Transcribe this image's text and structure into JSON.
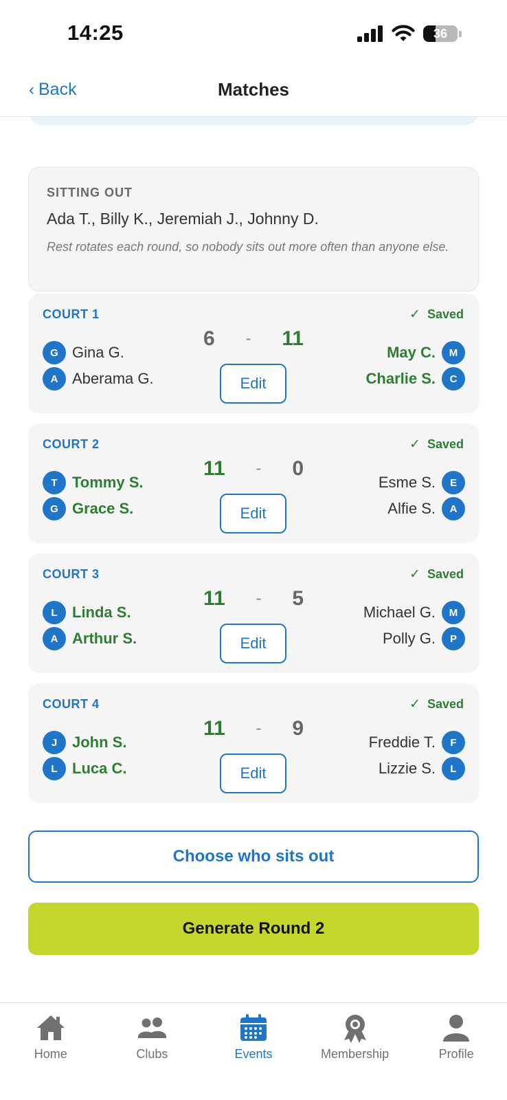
{
  "status_bar": {
    "time": "14:25",
    "battery": "36",
    "battery_level": 0.36
  },
  "nav": {
    "back_label": "Back",
    "title": "Matches"
  },
  "sitting_out": {
    "heading": "SITTING OUT",
    "names": "Ada T., Billy K., Jeremiah J., Johnny D.",
    "note": "Rest rotates each round, so nobody sits out more often than anyone else."
  },
  "courts": [
    {
      "label": "COURT 1",
      "status": "Saved",
      "edit_label": "Edit",
      "score_left": "6",
      "score_sep": "-",
      "score_right": "11",
      "winner": "right",
      "left_players": [
        {
          "initial": "G",
          "name": "Gina G."
        },
        {
          "initial": "A",
          "name": "Aberama G."
        }
      ],
      "right_players": [
        {
          "initial": "M",
          "name": "May C."
        },
        {
          "initial": "C",
          "name": "Charlie S."
        }
      ]
    },
    {
      "label": "COURT 2",
      "status": "Saved",
      "edit_label": "Edit",
      "score_left": "11",
      "score_sep": "-",
      "score_right": "0",
      "winner": "left",
      "left_players": [
        {
          "initial": "T",
          "name": "Tommy S."
        },
        {
          "initial": "G",
          "name": "Grace S."
        }
      ],
      "right_players": [
        {
          "initial": "E",
          "name": "Esme S."
        },
        {
          "initial": "A",
          "name": "Alfie S."
        }
      ]
    },
    {
      "label": "COURT 3",
      "status": "Saved",
      "edit_label": "Edit",
      "score_left": "11",
      "score_sep": "-",
      "score_right": "5",
      "winner": "left",
      "left_players": [
        {
          "initial": "L",
          "name": "Linda S."
        },
        {
          "initial": "A",
          "name": "Arthur S."
        }
      ],
      "right_players": [
        {
          "initial": "M",
          "name": "Michael G."
        },
        {
          "initial": "P",
          "name": "Polly G."
        }
      ]
    },
    {
      "label": "COURT 4",
      "status": "Saved",
      "edit_label": "Edit",
      "score_left": "11",
      "score_sep": "-",
      "score_right": "9",
      "winner": "left",
      "left_players": [
        {
          "initial": "J",
          "name": "John S."
        },
        {
          "initial": "L",
          "name": "Luca C."
        }
      ],
      "right_players": [
        {
          "initial": "F",
          "name": "Freddie T."
        },
        {
          "initial": "L",
          "name": "Lizzie S."
        }
      ]
    }
  ],
  "actions": {
    "choose_label": "Choose who sits out",
    "generate_label": "Generate Round 2"
  },
  "tabs": [
    {
      "label": "Home",
      "icon": "home-icon",
      "active": false
    },
    {
      "label": "Clubs",
      "icon": "clubs-icon",
      "active": false
    },
    {
      "label": "Events",
      "icon": "calendar-icon",
      "active": true
    },
    {
      "label": "Membership",
      "icon": "membership-badge-icon",
      "active": false
    },
    {
      "label": "Profile",
      "icon": "profile-icon",
      "active": false
    }
  ],
  "colors": {
    "accent": "#1f76c9",
    "win_green": "#2e7d32",
    "generate_button": "#c5d62d",
    "card_background": "#f5f5f5",
    "tab_inactive": "#707070"
  }
}
